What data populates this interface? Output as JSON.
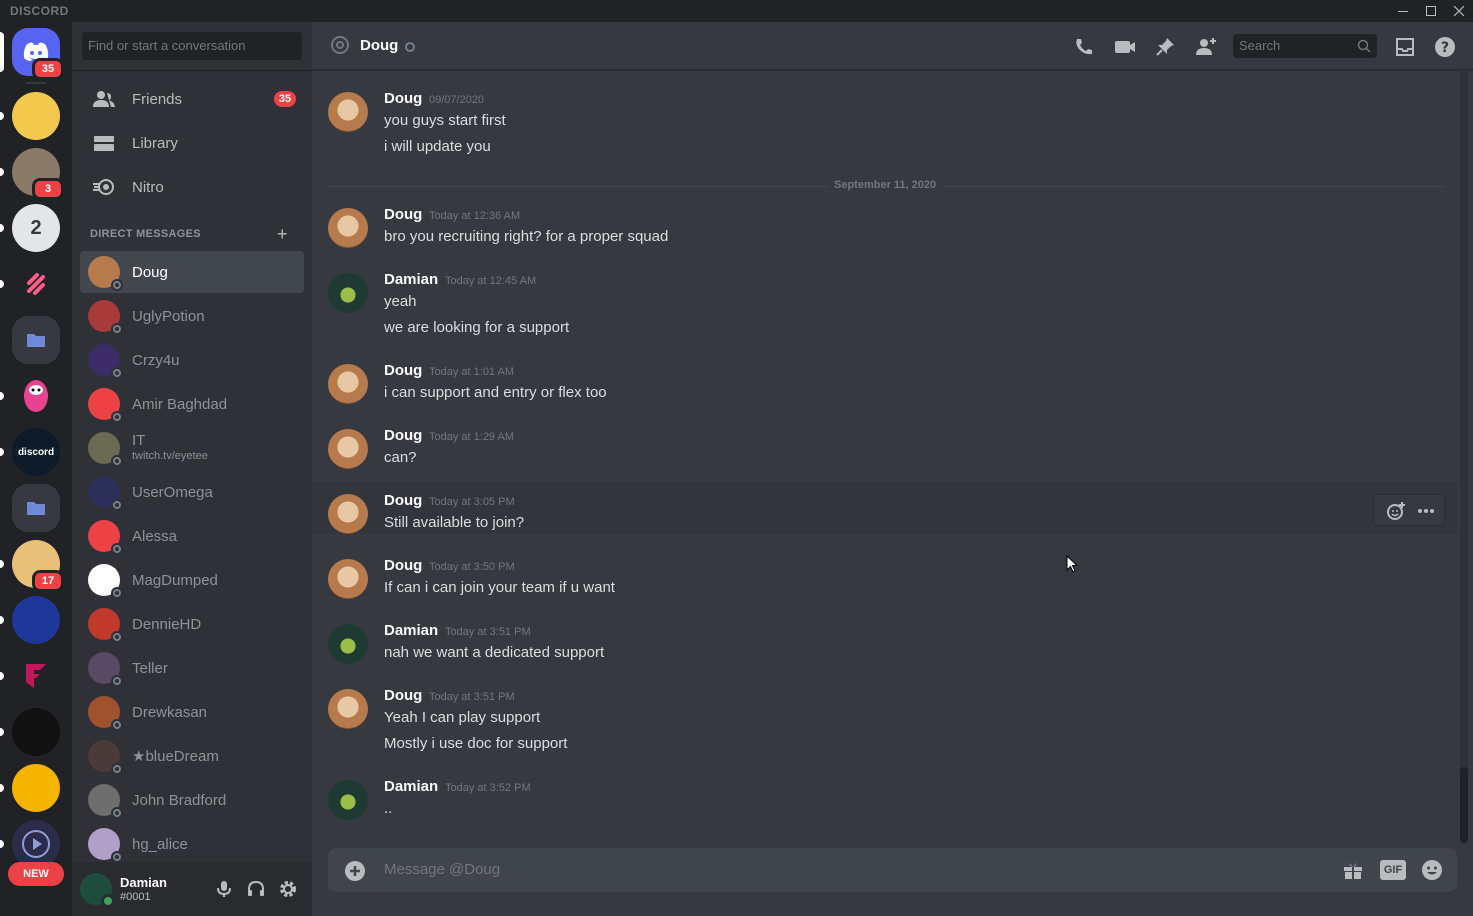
{
  "app": {
    "brand": "DISCORD"
  },
  "window_controls": [
    "minimize",
    "maximize",
    "close"
  ],
  "guilds": {
    "home_badge": "35",
    "items": [
      {
        "name": "server-1",
        "badge": ""
      },
      {
        "name": "server-2",
        "badge": "3"
      },
      {
        "name": "server-3",
        "badge": ""
      },
      {
        "name": "server-4",
        "badge": ""
      },
      {
        "name": "folder-1",
        "badge": ""
      },
      {
        "name": "server-5",
        "badge": ""
      },
      {
        "name": "server-discord-bio",
        "badge": "",
        "label": "discord"
      },
      {
        "name": "folder-2",
        "badge": ""
      },
      {
        "name": "server-6",
        "badge": "17"
      },
      {
        "name": "server-7",
        "badge": ""
      },
      {
        "name": "server-8",
        "badge": ""
      },
      {
        "name": "server-9",
        "badge": ""
      },
      {
        "name": "server-10",
        "badge": ""
      },
      {
        "name": "server-11",
        "badge": ""
      }
    ],
    "new_label": "NEW"
  },
  "sidebar": {
    "search_placeholder": "Find or start a conversation",
    "nav": [
      {
        "label": "Friends",
        "badge": "35"
      },
      {
        "label": "Library",
        "badge": ""
      },
      {
        "label": "Nitro",
        "badge": ""
      }
    ],
    "dm_header": "DIRECT MESSAGES",
    "dms": [
      {
        "name": "Doug",
        "sub": "",
        "color": "#b77a4c"
      },
      {
        "name": "UglyPotion",
        "sub": "",
        "color": "#a83a3a"
      },
      {
        "name": "Crzy4u",
        "sub": "",
        "color": "#3b2b66"
      },
      {
        "name": "Amir Baghdad",
        "sub": "",
        "color": "#ed4245"
      },
      {
        "name": "IT",
        "sub": "twitch.tv/eyetee",
        "color": "#6b6b55"
      },
      {
        "name": "UserOmega",
        "sub": "",
        "color": "#2c2f5a"
      },
      {
        "name": "Alessa",
        "sub": "",
        "color": "#ed4245"
      },
      {
        "name": "MagDumped",
        "sub": "",
        "color": "#ffffff"
      },
      {
        "name": "DennieHD",
        "sub": "",
        "color": "#c0392b"
      },
      {
        "name": "Teller",
        "sub": "",
        "color": "#5a4a66"
      },
      {
        "name": "Drewkasan",
        "sub": "",
        "color": "#a0522d"
      },
      {
        "name": "★blueDream",
        "sub": "",
        "color": "#4a3a3a"
      },
      {
        "name": "John Bradford",
        "sub": "",
        "color": "#6e6e6e"
      },
      {
        "name": "hg_alice",
        "sub": "",
        "color": "#b0a0c8"
      }
    ]
  },
  "user": {
    "name": "Damian",
    "tag": "#0001"
  },
  "chat": {
    "title": "Doug",
    "search_placeholder": "Search",
    "date_divider": "September 11, 2020",
    "messages": [
      {
        "author": "Doug",
        "time": "09/07/2020",
        "lines": [
          "you guys start first",
          "i will update you"
        ]
      },
      {
        "author": "Doug",
        "time": "Today at 12:36 AM",
        "lines": [
          "bro you recruiting right? for a proper squad"
        ]
      },
      {
        "author": "Damian",
        "time": "Today at 12:45 AM",
        "lines": [
          "yeah",
          "we are looking for a support"
        ]
      },
      {
        "author": "Doug",
        "time": "Today at 1:01 AM",
        "lines": [
          "i can support and entry or flex too"
        ]
      },
      {
        "author": "Doug",
        "time": "Today at 1:29 AM",
        "lines": [
          "can?"
        ]
      },
      {
        "author": "Doug",
        "time": "Today at 3:05 PM",
        "lines": [
          "Still available to join?"
        ]
      },
      {
        "author": "Doug",
        "time": "Today at 3:50 PM",
        "lines": [
          "If can i can join your team if u want"
        ]
      },
      {
        "author": "Damian",
        "time": "Today at 3:51 PM",
        "lines": [
          "nah we want a dedicated support"
        ]
      },
      {
        "author": "Doug",
        "time": "Today at 3:51 PM",
        "lines": [
          "Yeah I can play support",
          "Mostly i use doc for support"
        ]
      },
      {
        "author": "Damian",
        "time": "Today at 3:52 PM",
        "lines": [
          ".."
        ]
      }
    ],
    "composer_placeholder": "Message @Doug",
    "gif_label": "GIF"
  }
}
